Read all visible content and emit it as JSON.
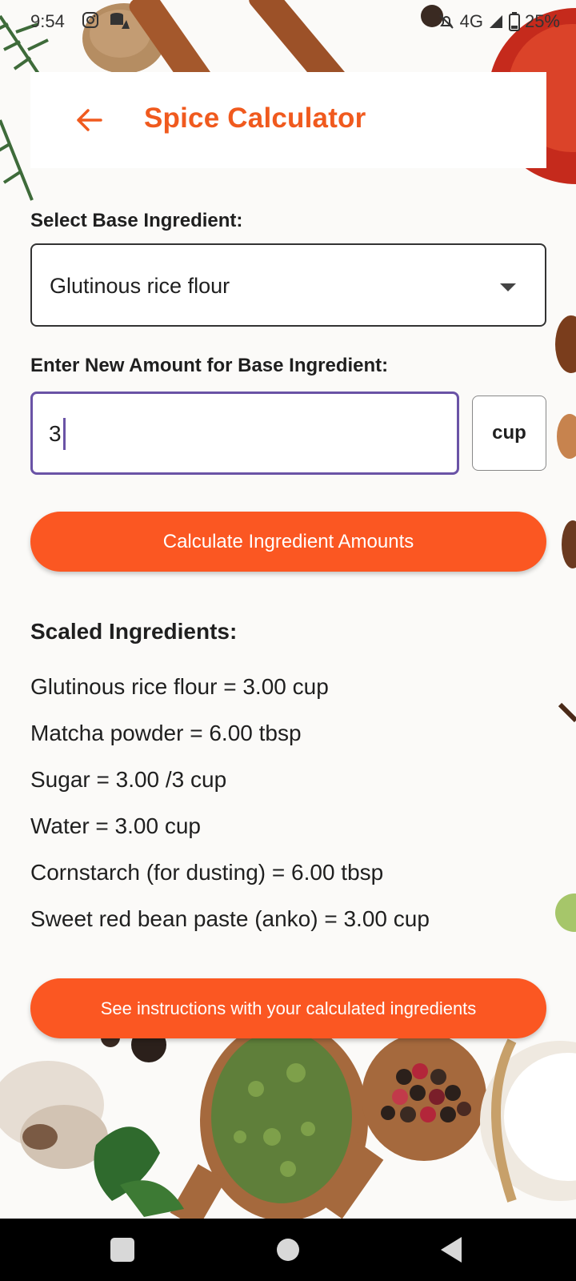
{
  "status_bar": {
    "time": "9:54",
    "network": "4G",
    "battery": "25%"
  },
  "app_bar": {
    "title": "Spice Calculator"
  },
  "form": {
    "base_label": "Select Base Ingredient:",
    "base_selected": "Glutinous rice flour",
    "amount_label": "Enter New Amount for Base Ingredient:",
    "amount_value": "3",
    "unit_label": "cup",
    "calculate_label": "Calculate Ingredient Amounts"
  },
  "results": {
    "title": "Scaled Ingredients:",
    "items": [
      "Glutinous rice flour = 3.00 cup",
      "Matcha powder = 6.00 tbsp",
      "Sugar = 3.00 /3 cup",
      "Water = 3.00 cup",
      "Cornstarch (for dusting) = 6.00 tbsp",
      "Sweet red bean paste (anko) = 3.00 cup"
    ],
    "instructions_label": "See instructions with your calculated ingredients"
  },
  "colors": {
    "accent": "#fb5722",
    "title": "#f05a1e",
    "focus": "#6a53a6"
  }
}
